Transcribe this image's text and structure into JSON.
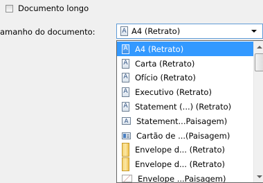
{
  "options": {
    "long_document_label": "Documento longo",
    "long_document_checked": false
  },
  "document_size": {
    "label": "amanho do documento:",
    "selected_value": "A4 (Retrato)",
    "items": [
      {
        "label": "A4 (Retrato)",
        "icon": "portrait-page-icon",
        "selected": true
      },
      {
        "label": "Carta (Retrato)",
        "icon": "portrait-page-icon",
        "selected": false
      },
      {
        "label": "Ofício (Retrato)",
        "icon": "portrait-page-icon",
        "selected": false
      },
      {
        "label": "Executivo (Retrato)",
        "icon": "portrait-page-icon",
        "selected": false
      },
      {
        "label": "Statement (...) (Retrato)",
        "icon": "portrait-page-icon",
        "selected": false
      },
      {
        "label": "Statement...Paisagem)",
        "icon": "landscape-page-icon",
        "selected": false
      },
      {
        "label": "Cartão de ...(Paisagem)",
        "icon": "business-card-icon",
        "selected": false
      },
      {
        "label": "Envelope d... (Retrato)",
        "icon": "envelope-portrait-icon",
        "selected": false
      },
      {
        "label": "Envelope d... (Retrato)",
        "icon": "envelope-portrait-icon",
        "selected": false
      },
      {
        "label": "Envelope ...Paisagem)",
        "icon": "envelope-landscape-icon",
        "selected": false
      }
    ]
  },
  "colors": {
    "selection": "#3399ff",
    "combo_border": "#5f9bd6"
  }
}
